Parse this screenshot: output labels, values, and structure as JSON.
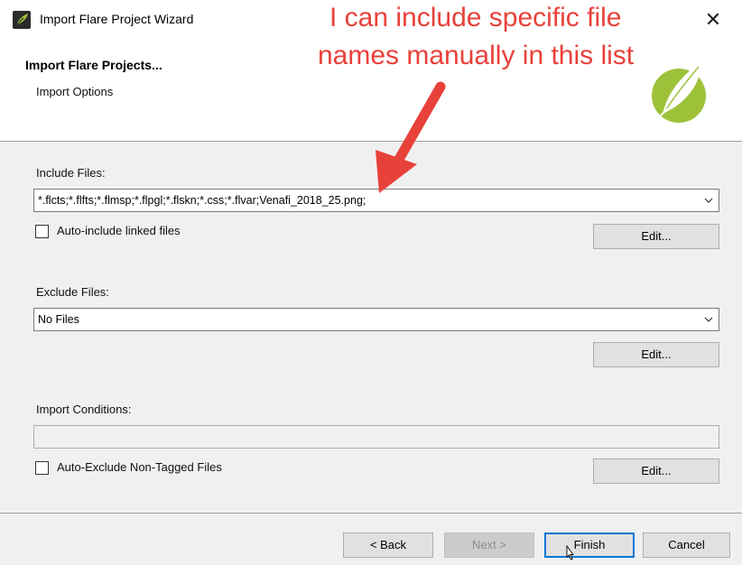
{
  "window": {
    "title": "Import Flare Project Wizard",
    "close_glyph": "✕"
  },
  "header": {
    "title": "Import Flare Projects...",
    "subtitle": "Import Options",
    "logo_icon": "flare-feather-logo-icon"
  },
  "include": {
    "label": "Include Files:",
    "value": "*.flcts;*.flfts;*.flmsp;*.flpgl;*.flskn;*.css;*.flvar;Venafi_2018_25.png;",
    "auto_label": "Auto-include linked files",
    "auto_checked": false,
    "edit_label": "Edit..."
  },
  "exclude": {
    "label": "Exclude Files:",
    "value": "No Files",
    "edit_label": "Edit..."
  },
  "conditions": {
    "label": "Import Conditions:",
    "value": "",
    "auto_label": "Auto-Exclude Non-Tagged Files",
    "auto_checked": false,
    "edit_label": "Edit..."
  },
  "footer": {
    "back_label": "< Back",
    "next_label": "Next >",
    "finish_label": "Finish",
    "cancel_label": "Cancel"
  },
  "annotation": {
    "line1": "I can include specific file",
    "line2": "names manually in this list",
    "color": "#e8413a"
  }
}
